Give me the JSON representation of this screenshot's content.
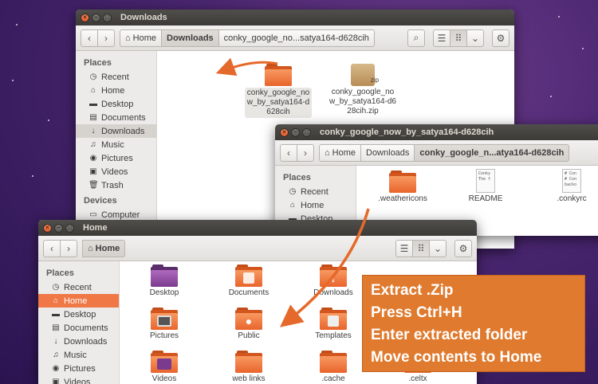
{
  "colors": {
    "accent": "#f07746",
    "callout": "#df7a2e",
    "titlebar": "#3c3b37"
  },
  "window_downloads": {
    "title": "Downloads",
    "crumbs": [
      "Home",
      "Downloads",
      "conky_google_no...satya164-d628cih"
    ],
    "sidebar": {
      "places_heading": "Places",
      "items": [
        {
          "label": "Recent",
          "icon": "clock-icon"
        },
        {
          "label": "Home",
          "icon": "home-icon"
        },
        {
          "label": "Desktop",
          "icon": "desktop-icon"
        },
        {
          "label": "Documents",
          "icon": "documents-icon"
        },
        {
          "label": "Downloads",
          "icon": "download-icon"
        },
        {
          "label": "Music",
          "icon": "music-icon"
        },
        {
          "label": "Pictures",
          "icon": "camera-icon"
        },
        {
          "label": "Videos",
          "icon": "video-icon"
        },
        {
          "label": "Trash",
          "icon": "trash-icon"
        }
      ],
      "devices_heading": "Devices",
      "devices": [
        {
          "label": "Computer",
          "icon": "computer-icon"
        }
      ]
    },
    "files": [
      {
        "label": "conky_google_now_by_satya164-d628cih",
        "type": "folder"
      },
      {
        "label": "conky_google_now_by_satya164-d628cih.zip",
        "type": "zip",
        "badge": "zip"
      }
    ]
  },
  "window_conky": {
    "title": "conky_google_now_by_satya164-d628cih",
    "crumbs": [
      "Home",
      "Downloads",
      "conky_google_n...atya164-d628cih"
    ],
    "sidebar": {
      "places_heading": "Places",
      "items": [
        {
          "label": "Recent",
          "icon": "clock-icon"
        },
        {
          "label": "Home",
          "icon": "home-icon"
        },
        {
          "label": "Desktop",
          "icon": "desktop-icon"
        }
      ]
    },
    "files": [
      {
        "label": ".weathericons",
        "type": "folder"
      },
      {
        "label": "README",
        "type": "text",
        "preview": "Conky\nThe f"
      },
      {
        "label": ".conkyrc",
        "type": "text",
        "preview": "# Con\n# Con\nbacko"
      }
    ]
  },
  "window_home": {
    "title": "Home",
    "crumbs": [
      "Home"
    ],
    "sidebar": {
      "places_heading": "Places",
      "items": [
        {
          "label": "Recent",
          "icon": "clock-icon"
        },
        {
          "label": "Home",
          "icon": "home-icon"
        },
        {
          "label": "Desktop",
          "icon": "desktop-icon"
        },
        {
          "label": "Documents",
          "icon": "documents-icon"
        },
        {
          "label": "Downloads",
          "icon": "download-icon"
        },
        {
          "label": "Music",
          "icon": "music-icon"
        },
        {
          "label": "Pictures",
          "icon": "camera-icon"
        },
        {
          "label": "Videos",
          "icon": "video-icon"
        }
      ]
    },
    "files": [
      {
        "label": "Desktop",
        "type": "folder"
      },
      {
        "label": "Documents",
        "type": "folder"
      },
      {
        "label": "Downloads",
        "type": "folder"
      },
      {
        "label": "Pictures",
        "type": "folder"
      },
      {
        "label": "Public",
        "type": "folder"
      },
      {
        "label": "Templates",
        "type": "folder"
      },
      {
        "label": "Videos",
        "type": "folder"
      },
      {
        "label": "web links",
        "type": "folder"
      },
      {
        "label": ".cache",
        "type": "folder"
      },
      {
        "label": ".celtx",
        "type": "folder"
      }
    ]
  },
  "callout": {
    "lines": [
      "Extract .Zip",
      "Press Ctrl+H",
      "Enter extracted folder",
      "Move contents to Home"
    ]
  }
}
